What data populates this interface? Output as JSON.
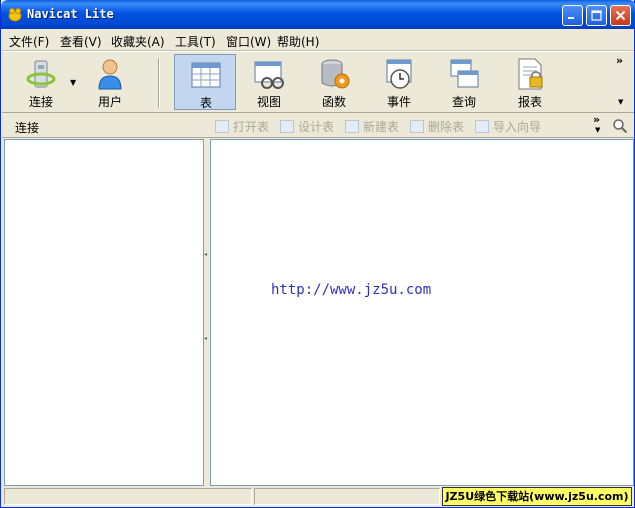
{
  "window": {
    "title": "Navicat Lite"
  },
  "menu": [
    {
      "label": "文件(F)"
    },
    {
      "label": "查看(V)"
    },
    {
      "label": "收藏夹(A)"
    },
    {
      "label": "工具(T)"
    },
    {
      "label": "窗口(W)"
    },
    {
      "label": "帮助(H)"
    }
  ],
  "toolbar": {
    "items": [
      {
        "label": "连接",
        "icon": "connection-icon"
      },
      {
        "label": "用户",
        "icon": "user-icon"
      },
      {
        "label": "表",
        "icon": "table-icon",
        "active": true
      },
      {
        "label": "视图",
        "icon": "view-icon"
      },
      {
        "label": "函数",
        "icon": "function-icon"
      },
      {
        "label": "事件",
        "icon": "event-icon"
      },
      {
        "label": "查询",
        "icon": "query-icon"
      },
      {
        "label": "报表",
        "icon": "report-icon"
      }
    ],
    "more": "»"
  },
  "subbar": {
    "title": "连接",
    "buttons": [
      {
        "label": "打开表"
      },
      {
        "label": "设计表"
      },
      {
        "label": "新建表"
      },
      {
        "label": "删除表"
      },
      {
        "label": "导入向导"
      }
    ],
    "more": "»"
  },
  "content": {
    "watermark_url": "http://www.jz5u.com"
  },
  "status": {
    "brand_badge": "JZ5U绿色下载站(www.jz5u.com)"
  },
  "colors": {
    "titlebar": "#0054e3",
    "active_tool": "#c4d6ef",
    "link": "#3030c0",
    "badge": "#ffff66"
  }
}
